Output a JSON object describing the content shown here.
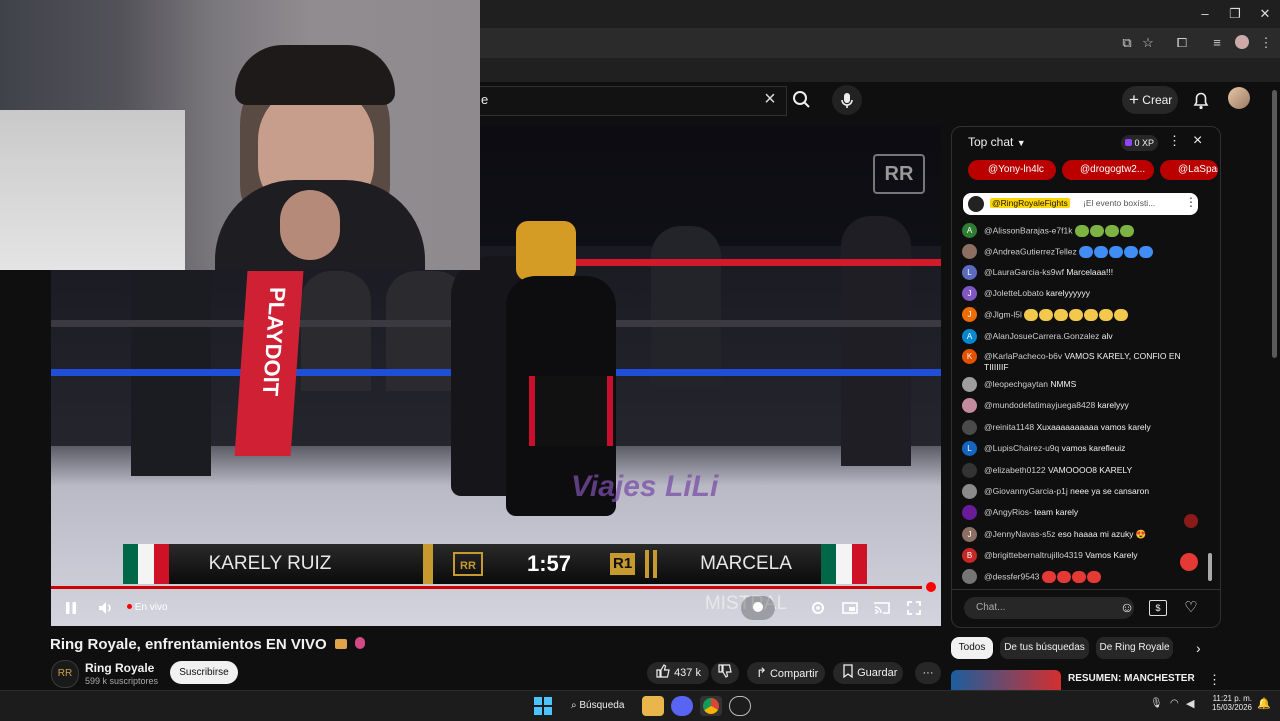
{
  "browser": {
    "window_controls": [
      "–",
      "❐",
      "✕"
    ]
  },
  "header": {
    "search_text": "e",
    "create_label": "Crear"
  },
  "video": {
    "scoreboard": {
      "left_fighter": "KARELY RUIZ",
      "time": "1:57",
      "round": "R1",
      "right_fighter": "MARCELA MISTRAL"
    },
    "ring_sign": "PLAYDOIT",
    "sponsor": "Viajes LiLi",
    "live_label": "En vivo",
    "progress": 0.99,
    "colors": {
      "accent": "#ff0000",
      "rope_red": "#d21a2a",
      "rope_blue": "#1f4fd8"
    }
  },
  "info": {
    "title": "Ring Royale, enfrentamientos EN VIVO",
    "channel": "Ring Royale",
    "subscribers": "599 k suscriptores",
    "subscribe_label": "Suscribirse",
    "likes": "437 k",
    "share_label": "Compartir",
    "save_label": "Guardar"
  },
  "chat": {
    "header": "Top chat",
    "xp": "0 XP",
    "chips": [
      "@Yony-ln4lc",
      "@drogogtw2...",
      "@LaSpar"
    ],
    "pinned_author": "@RingRoyaleFights",
    "pinned_text": "¡El evento boxísti...",
    "messages": [
      {
        "author": "@AlissonBarajas-e7f1k",
        "text": "",
        "initial": "A",
        "color": "#2e7d32",
        "stickers": [
          "#7cb342",
          "#7cb342",
          "#7cb342",
          "#7cb342"
        ]
      },
      {
        "author": "@AndreaGutierrezTellez",
        "text": "",
        "initial": "",
        "color": "#8d6e63",
        "stickers": [
          "#3f8df5",
          "#3f8df5",
          "#3f8df5",
          "#3f8df5",
          "#3f8df5"
        ]
      },
      {
        "author": "@LauraGarcia-ks9wf",
        "text": "Marcelaaa!!!",
        "initial": "L",
        "color": "#5c6bc0",
        "stickers": []
      },
      {
        "author": "@JoletteLobato",
        "text": "karelyyyyyy",
        "initial": "J",
        "color": "#7e57c2",
        "stickers": []
      },
      {
        "author": "@Jlgm-l5l",
        "text": "",
        "initial": "J",
        "color": "#ef6c00",
        "stickers": [
          "#f2c94c",
          "#f2c94c",
          "#f2c94c",
          "#f2c94c",
          "#f2c94c",
          "#f2c94c",
          "#f2c94c"
        ]
      },
      {
        "author": "@AlanJosueCarrera.Gonzalez",
        "text": "alv",
        "initial": "A",
        "color": "#0288d1",
        "stickers": []
      },
      {
        "author": "@KarlaPacheco-b6v",
        "text": "VAMOS KARELY, CONFIO EN TIIIIIIF",
        "initial": "K",
        "color": "#e65100",
        "stickers": []
      },
      {
        "author": "@leopechgaytan",
        "text": "NMMS",
        "initial": "",
        "color": "#9e9e9e",
        "stickers": []
      },
      {
        "author": "@mundodefatimayjuega8428",
        "text": "karelyyy",
        "initial": "",
        "color": "#c48b9f",
        "stickers": []
      },
      {
        "author": "@reinita1148",
        "text": "Xuxaaaaaaaaaa vamos karely",
        "initial": "",
        "color": "#4a4a4a",
        "stickers": []
      },
      {
        "author": "@LupisChairez-u9q",
        "text": "vamos karefleuiz",
        "initial": "L",
        "color": "#1565c0",
        "stickers": []
      },
      {
        "author": "@elizabeth0122",
        "text": "VAMOOOO8 KARELY",
        "initial": "",
        "color": "#333333",
        "stickers": []
      },
      {
        "author": "@GiovannyGarcia-p1j",
        "text": "neee ya se cansaron",
        "initial": "",
        "color": "#8a8a8a",
        "stickers": []
      },
      {
        "author": "@AngyRios-",
        "text": "team karely",
        "initial": "",
        "color": "#6a1b9a",
        "stickers": []
      },
      {
        "author": "@JennyNavas-s5z",
        "text": "eso haaaa mi azuky 😍",
        "initial": "J",
        "color": "#8d6e63",
        "stickers": []
      },
      {
        "author": "@brigittebernaltrujillo4319",
        "text": "Vamos Karely",
        "initial": "B",
        "color": "#c62828",
        "stickers": []
      },
      {
        "author": "@dessfer9543",
        "text": "",
        "initial": "",
        "color": "#757575",
        "stickers": [
          "#e53935",
          "#e53935",
          "#e53935",
          "#e53935"
        ]
      }
    ],
    "input_placeholder": "Chat..."
  },
  "related": {
    "chips": [
      "Todos",
      "De tus búsquedas",
      "De Ring Royale"
    ],
    "first_title": "RESUMEN: MANCHESTER"
  },
  "taskbar": {
    "search_label": "Búsqueda",
    "time": "11:21 p. m.",
    "date": "15/03/2026"
  }
}
